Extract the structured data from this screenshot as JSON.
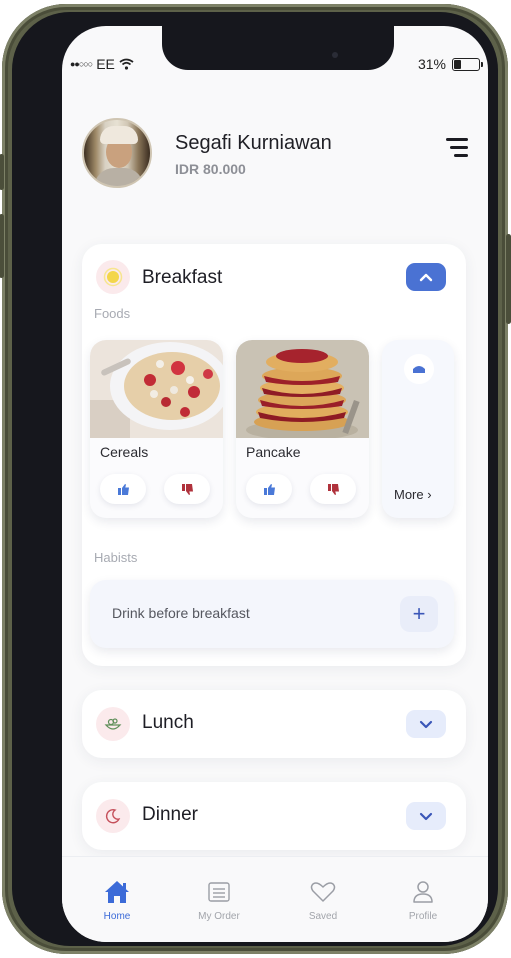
{
  "status_bar": {
    "signal": "●●○○○",
    "carrier": "EE",
    "wifi": "wifi-icon",
    "battery_percent": "31%",
    "battery_level": 0.31
  },
  "profile": {
    "name": "Segafi Kurniawan",
    "balance": "IDR 80.000"
  },
  "meals": {
    "breakfast": {
      "title": "Breakfast",
      "expanded": true,
      "foods_label": "Foods",
      "foods": [
        {
          "name": "Cereals"
        },
        {
          "name": "Pancake"
        }
      ],
      "more_label": "More",
      "habits_label": "Habists",
      "habit": "Drink before breakfast",
      "add_symbol": "+"
    },
    "lunch": {
      "title": "Lunch",
      "expanded": false
    },
    "dinner": {
      "title": "Dinner",
      "expanded": false
    }
  },
  "tabs": [
    {
      "label": "Home",
      "icon": "home-icon",
      "active": true
    },
    {
      "label": "My Order",
      "icon": "order-icon",
      "active": false
    },
    {
      "label": "Saved",
      "icon": "heart-icon",
      "active": false
    },
    {
      "label": "Profile",
      "icon": "user-icon",
      "active": false
    }
  ],
  "colors": {
    "accent": "#4a72d3",
    "like": "#4a79d8",
    "dislike": "#b0323c"
  }
}
